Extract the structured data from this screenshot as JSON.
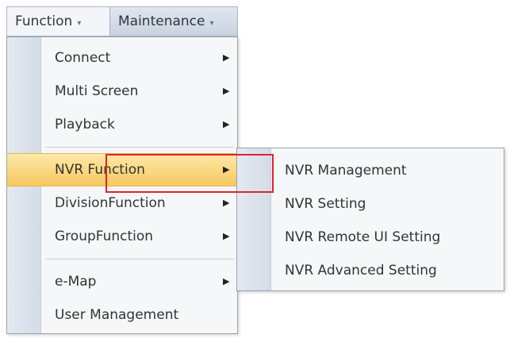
{
  "menubar": {
    "items": [
      {
        "label": "Function"
      },
      {
        "label": "Maintenance"
      }
    ],
    "caret": "▾"
  },
  "function_menu": {
    "items": [
      {
        "label": "Connect",
        "arrow": "▶"
      },
      {
        "label": "Multi Screen",
        "arrow": "▶"
      },
      {
        "label": "Playback",
        "arrow": "▶"
      },
      {
        "label": "NVR Function",
        "arrow": "▶"
      },
      {
        "label": "DivisionFunction",
        "arrow": "▶"
      },
      {
        "label": "GroupFunction",
        "arrow": "▶"
      },
      {
        "label": "e-Map",
        "arrow": "▶"
      },
      {
        "label": "User Management"
      }
    ]
  },
  "nvr_submenu": {
    "items": [
      {
        "label": "NVR Management"
      },
      {
        "label": "NVR Setting"
      },
      {
        "label": "NVR Remote UI Setting"
      },
      {
        "label": "NVR Advanced Setting"
      }
    ]
  },
  "colors": {
    "highlight": "#f7c860",
    "annotation": "#e0232b",
    "menubar": "#c9d3e0"
  }
}
